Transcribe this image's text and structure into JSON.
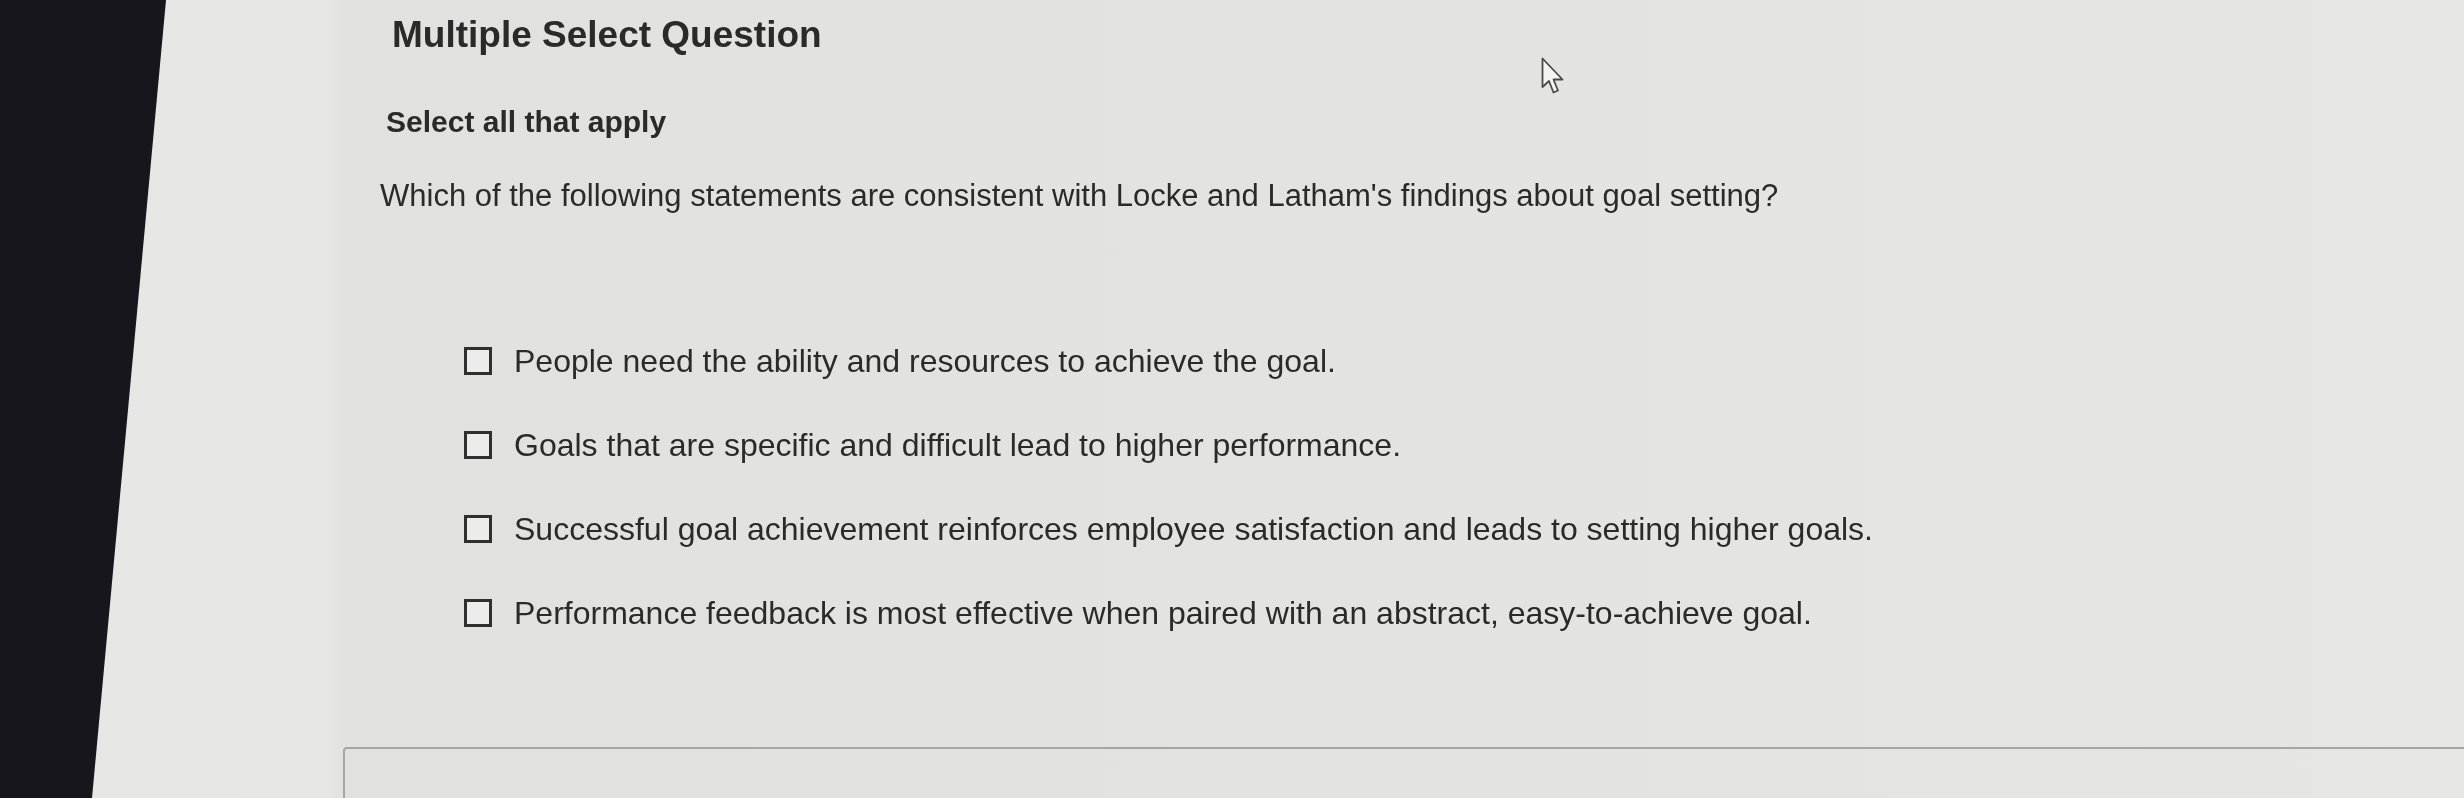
{
  "title": "Multiple Select Question",
  "instruction": "Select all that apply",
  "question": "Which of the following statements are consistent with Locke and Latham's findings about goal setting?",
  "options": [
    {
      "label": "People need the ability and resources to achieve the goal.",
      "checked": false
    },
    {
      "label": "Goals that are specific and difficult lead to higher performance.",
      "checked": false
    },
    {
      "label": "Successful goal achievement reinforces employee satisfaction and leads to setting higher goals.",
      "checked": false
    },
    {
      "label": "Performance feedback is most effective when paired with an abstract, easy-to-achieve goal.",
      "checked": false
    }
  ]
}
